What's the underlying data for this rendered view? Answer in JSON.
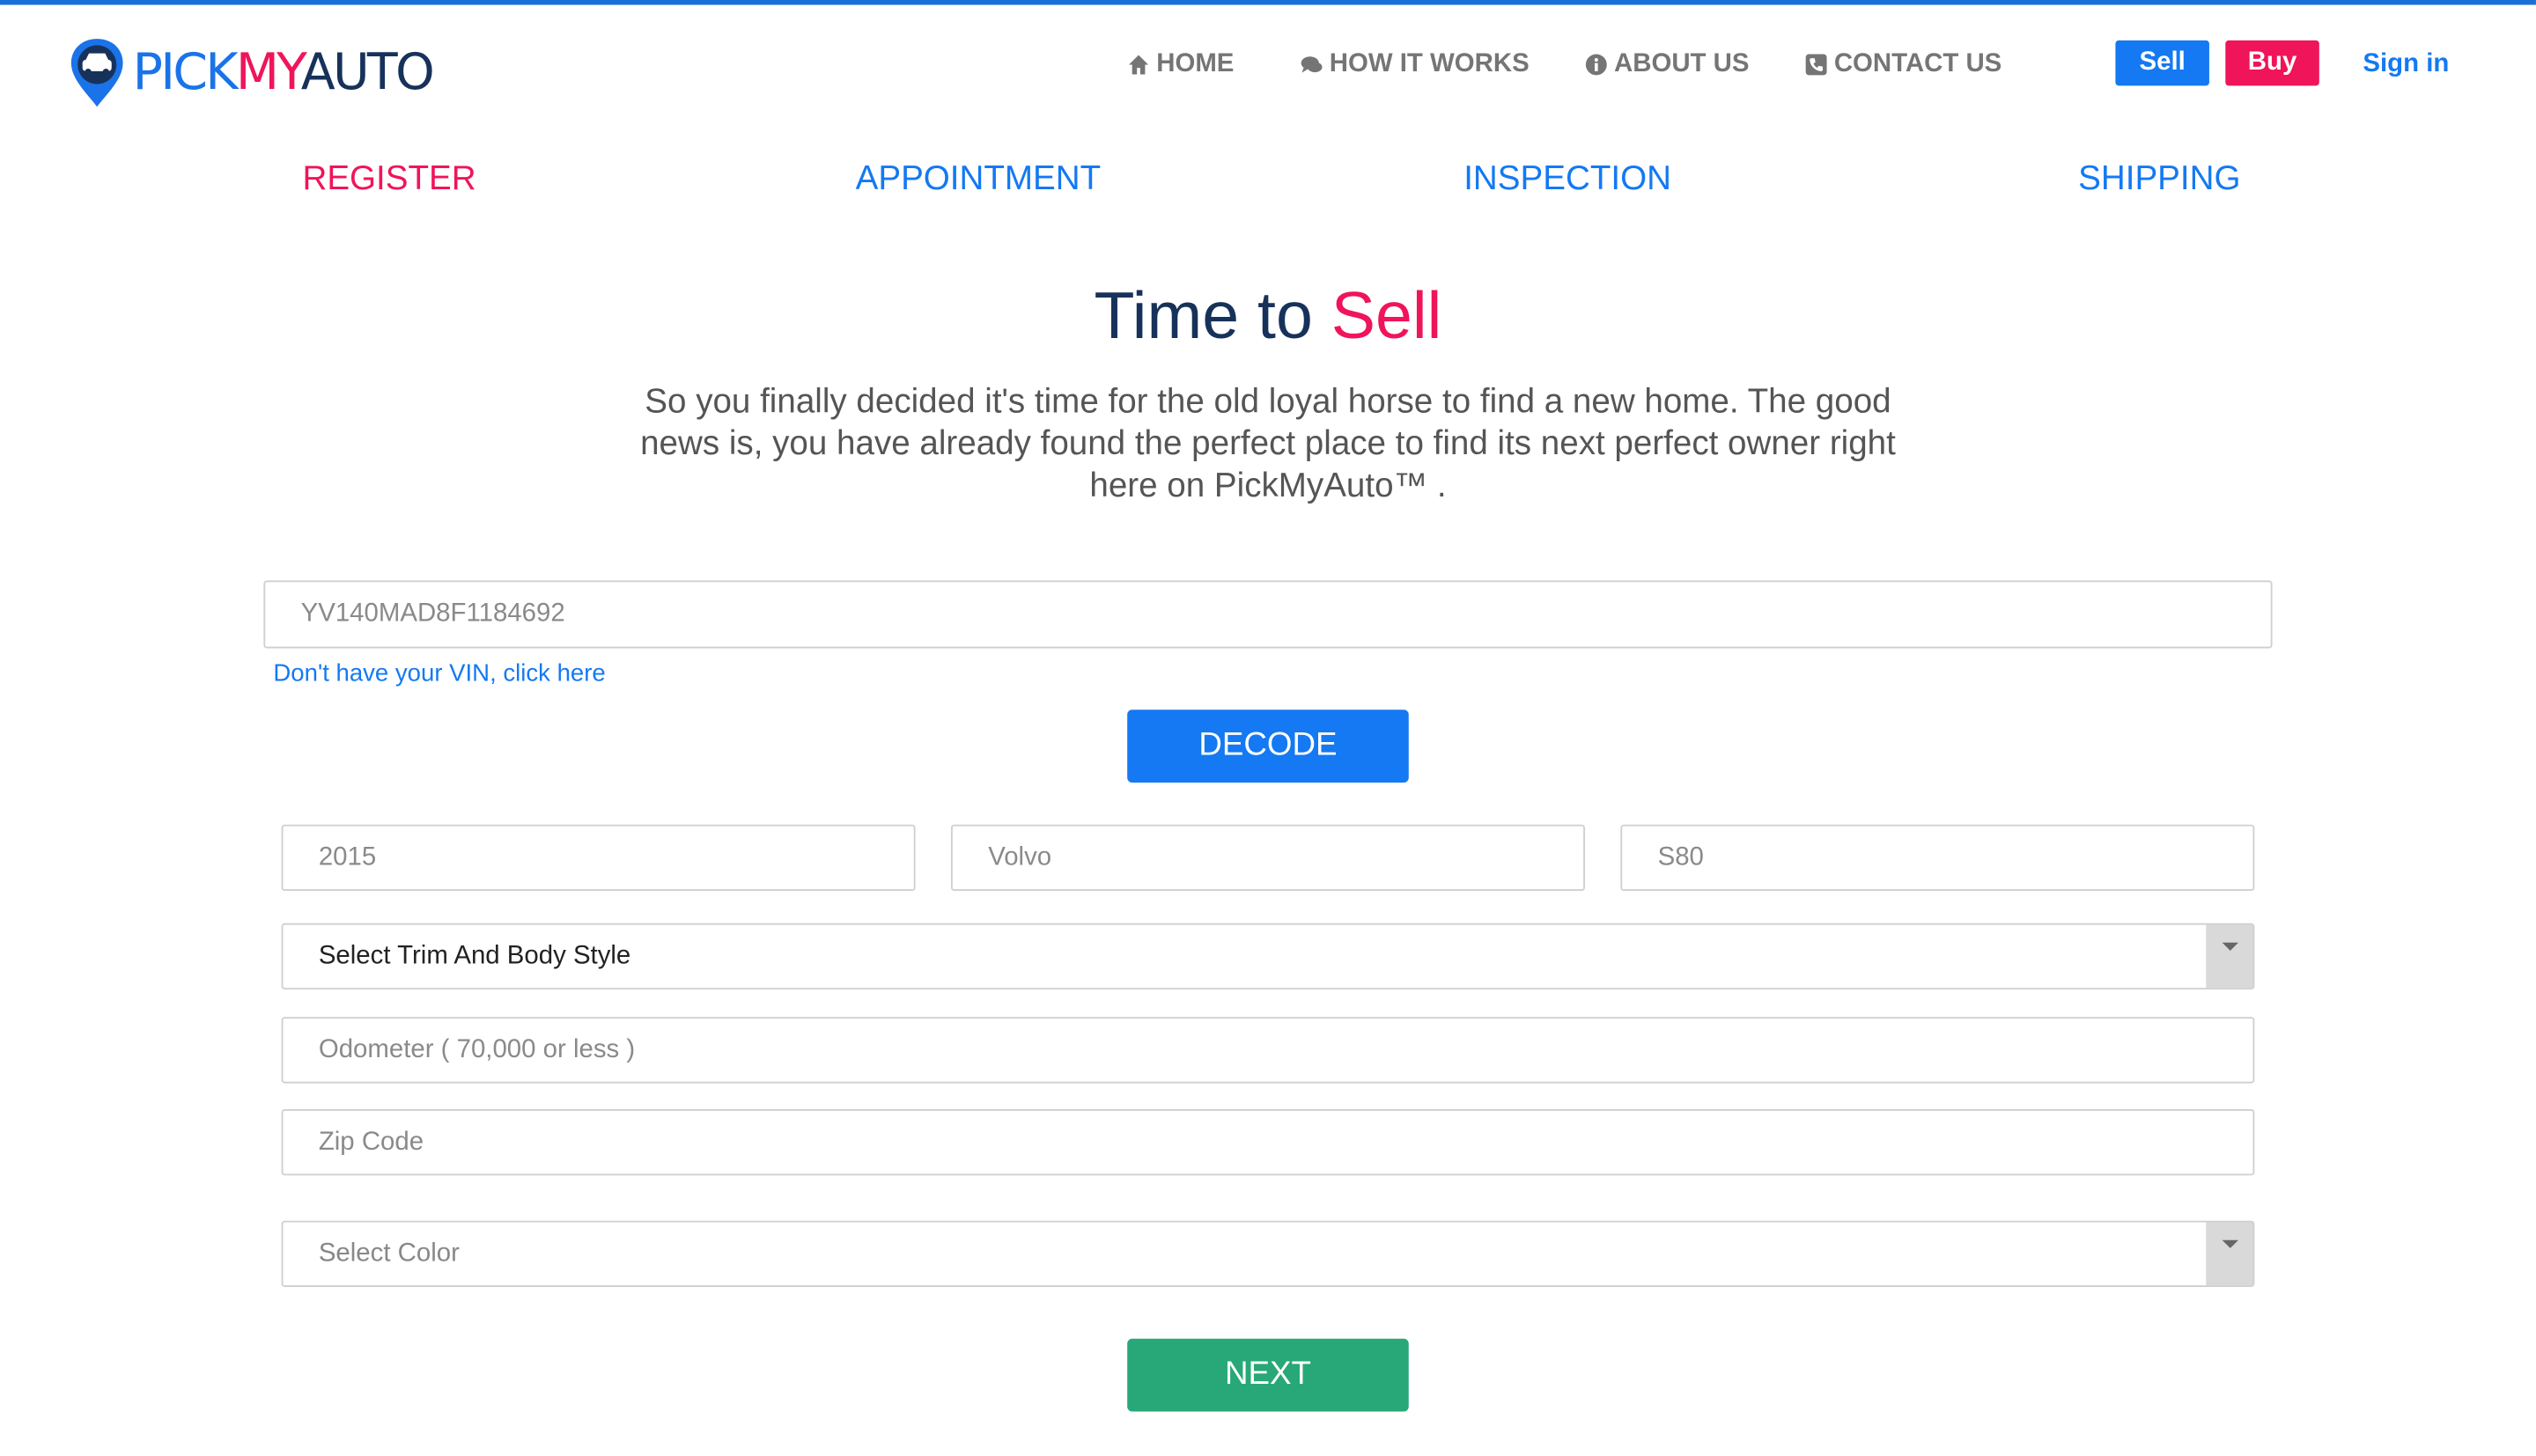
{
  "brand": {
    "logo_part1": "PICK",
    "logo_part2": "MY",
    "logo_part3": "AUTO",
    "colors": {
      "blue": "#1479f2",
      "pink": "#f0145a",
      "navy": "#17325a",
      "green": "#28a878"
    }
  },
  "nav": {
    "items": [
      {
        "label": "HOME",
        "icon": "home-icon"
      },
      {
        "label": "HOW IT WORKS",
        "icon": "comments-icon"
      },
      {
        "label": "ABOUT US",
        "icon": "info-icon"
      },
      {
        "label": "CONTACT US",
        "icon": "phone-icon"
      }
    ],
    "sell_label": "Sell",
    "buy_label": "Buy",
    "signin_label": "Sign in"
  },
  "steps": [
    {
      "label": "REGISTER",
      "active": true
    },
    {
      "label": "APPOINTMENT",
      "active": false
    },
    {
      "label": "INSPECTION",
      "active": false
    },
    {
      "label": "SHIPPING",
      "active": false
    }
  ],
  "hero": {
    "title_prefix": "Time to ",
    "title_highlight": "Sell",
    "lead": "So you finally decided it's time for the old loyal horse to find a new home. The good news is, you have already found the perfect place to find its next perfect owner right here on PickMyAuto™ ."
  },
  "form": {
    "vin_placeholder": "YV140MAD8F1184692",
    "vin_link": "Don't have your VIN, click here",
    "decode_label": "DECODE",
    "year_placeholder": "2015",
    "make_placeholder": "Volvo",
    "model_placeholder": "S80",
    "trim_selected": "Select Trim And Body Style",
    "odometer_placeholder": "Odometer ( 70,000 or less )",
    "zip_placeholder": "Zip Code",
    "color_selected": "Select Color",
    "next_label": "NEXT"
  }
}
